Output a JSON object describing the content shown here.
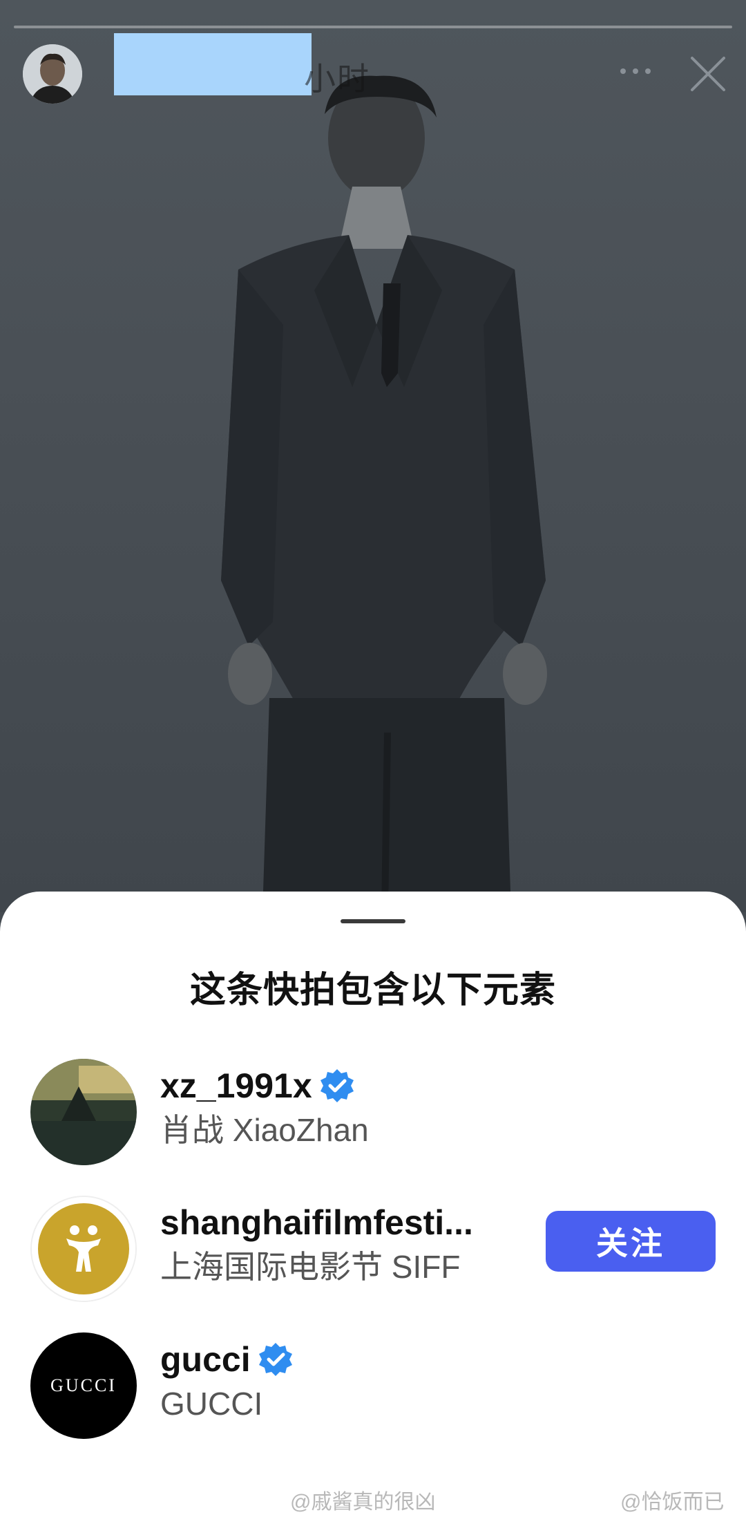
{
  "story": {
    "time_ago": "小时",
    "more_icon": "more-horizontal-icon",
    "close_icon": "close-icon"
  },
  "sheet": {
    "title": "这条快拍包含以下元素",
    "accounts": [
      {
        "username": "xz_1991x",
        "display_name": "肖战 XiaoZhan",
        "verified": true,
        "avatar": "dark-landscape-photo"
      },
      {
        "username": "shanghaifilmfesti...",
        "display_name": "上海国际电影节 SIFF",
        "verified": false,
        "avatar": "siff-gold-logo",
        "follow_label": "关注"
      },
      {
        "username": "gucci",
        "display_name": "GUCCI",
        "verified": true,
        "avatar": "gucci-wordmark-logo",
        "avatar_text": "GUCCI"
      }
    ]
  },
  "watermarks": {
    "left": "@戚酱真的很凶",
    "right": "@恰饭而已"
  },
  "colors": {
    "follow_button": "#4a5ff0",
    "verified_badge": "#2f8df0",
    "siff_gold": "#c9a42c"
  }
}
